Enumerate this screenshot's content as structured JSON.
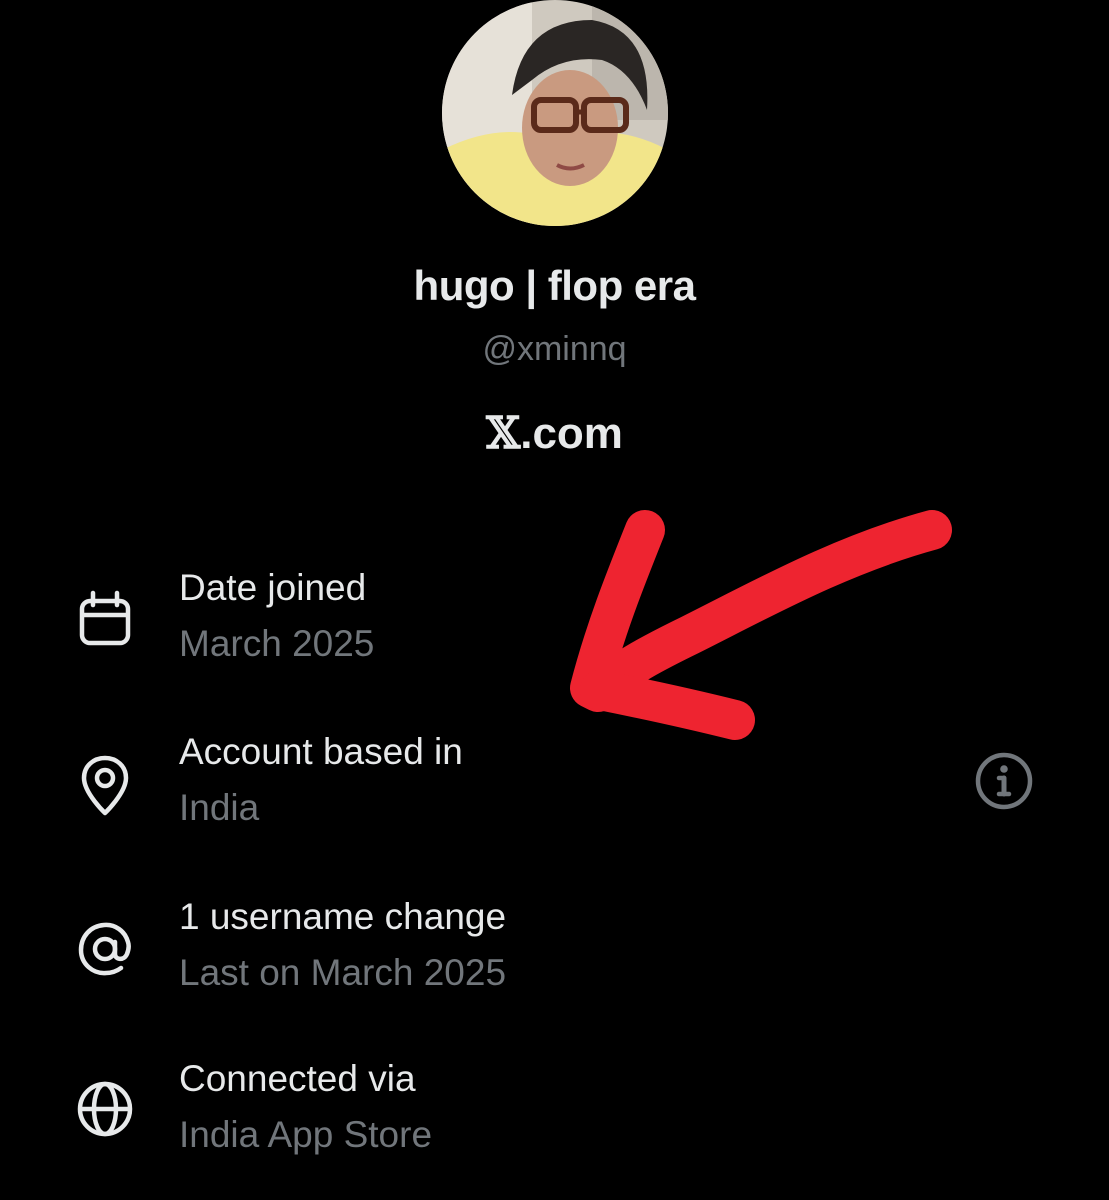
{
  "profile": {
    "display_name": "hugo | flop era",
    "handle": "@xminnq",
    "site_mark": "𝕏",
    "site_suffix": ".com"
  },
  "about": {
    "rows": [
      {
        "icon": "calendar-icon",
        "title": "Date joined",
        "value": "March 2025"
      },
      {
        "icon": "location-pin-icon",
        "title": "Account based in",
        "value": "India"
      },
      {
        "icon": "at-sign-icon",
        "title": "1 username change",
        "value": "Last on March 2025"
      },
      {
        "icon": "globe-icon",
        "title": "Connected via",
        "value": "India App Store"
      }
    ],
    "info_icon": "info-icon"
  },
  "annotation": {
    "shape": "arrow",
    "color": "#ee2430"
  },
  "colors": {
    "background": "#000000",
    "primary_text": "#e7e9ea",
    "secondary_text": "#71767b",
    "annotation_red": "#ee2430"
  }
}
